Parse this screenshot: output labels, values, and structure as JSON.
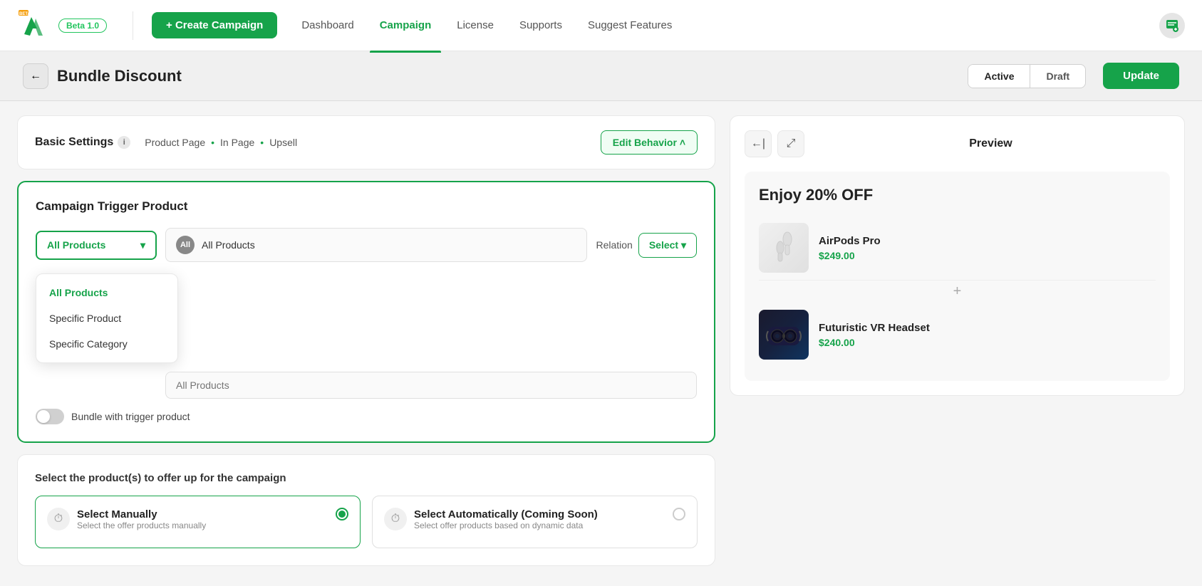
{
  "header": {
    "beta_label": "Beta 1.0",
    "create_campaign_label": "+ Create Campaign",
    "nav_items": [
      {
        "id": "dashboard",
        "label": "Dashboard",
        "active": false
      },
      {
        "id": "campaign",
        "label": "Campaign",
        "active": true
      },
      {
        "id": "license",
        "label": "License",
        "active": false
      },
      {
        "id": "supports",
        "label": "Supports",
        "active": false
      },
      {
        "id": "suggest",
        "label": "Suggest Features",
        "active": false
      }
    ]
  },
  "page_header": {
    "title": "Bundle Discount",
    "back_label": "←",
    "status_active": "Active",
    "status_draft": "Draft",
    "update_label": "Update"
  },
  "basic_settings": {
    "label": "Basic Settings",
    "behavior_tags": "Product Page  •  In Page  •  Upsell",
    "edit_behavior_label": "Edit Behavior  ˄"
  },
  "trigger_card": {
    "title": "Campaign Trigger Product",
    "dropdown_value": "All Products",
    "dropdown_chevron": "▾",
    "all_badge": "All",
    "all_products_text": "All Products",
    "relation_label": "Relation",
    "select_label": "Select ▾",
    "second_row_placeholder": "All Products",
    "dropdown_options": [
      {
        "id": "all",
        "label": "All Products",
        "selected": true
      },
      {
        "id": "specific",
        "label": "Specific Product",
        "selected": false
      },
      {
        "id": "category",
        "label": "Specific Category",
        "selected": false
      }
    ],
    "toggle_label": "Bundle with trigger product"
  },
  "offer_section": {
    "title": "Select the product(s) to offer up for the campaign",
    "options": [
      {
        "id": "manual",
        "title": "Select Manually",
        "subtitle": "Select the offer products manually",
        "selected": true,
        "icon": "⏱"
      },
      {
        "id": "auto",
        "title": "Select Automatically (Coming Soon)",
        "subtitle": "Select offer products based on dynamic data",
        "selected": false,
        "icon": "⏱"
      }
    ]
  },
  "preview": {
    "title": "Preview",
    "discount_header": "Enjoy 20% OFF",
    "products": [
      {
        "id": "airpods",
        "name": "AirPods Pro",
        "price": "$249.00",
        "image_type": "airpods"
      },
      {
        "id": "vr",
        "name": "Futuristic VR Headset",
        "price": "$240.00",
        "image_type": "vr"
      }
    ],
    "plus_symbol": "+"
  },
  "icons": {
    "back": "←",
    "collapse_left": "←|",
    "expand": "⤢",
    "chevron_down": "▾",
    "chevron_up": "˄",
    "info": "i",
    "plus": "+"
  }
}
